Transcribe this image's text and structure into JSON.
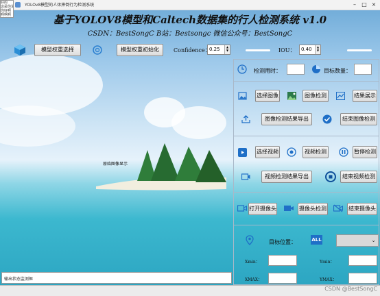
{
  "window": {
    "title": "YOLOv8模型的人体摔倒行为检测系统"
  },
  "sidebox": "好的\n这是你说的\n你好啊\n啊啊啊",
  "header": {
    "title": "基于YOLOV8模型和Caltech数据集的行人检测系统 v1.0",
    "subtitle": "CSDN：BestSongC   B站：Bestsongc   微信公众号：BestSongC"
  },
  "toolbar": {
    "model_select": "模型权重选择",
    "model_init": "模型权重初始化",
    "confidence_label": "Confidence：",
    "confidence_value": "0.25",
    "iou_label": "IOU：",
    "iou_value": "0.40"
  },
  "image_area": {
    "placeholder": "原始图像显示"
  },
  "stats": {
    "time_label": "检测用时：",
    "count_label": "目标数量："
  },
  "image_section": {
    "select": "选择图像",
    "detect": "图像检测",
    "show": "结果展示",
    "export": "图像检测结果导出",
    "end": "结束图像检测"
  },
  "video_section": {
    "select": "选择视频",
    "detect": "视频检测",
    "pause": "暂停检测",
    "export": "视频检测结果导出",
    "end": "结束视频检测"
  },
  "camera_section": {
    "open": "打开摄像头",
    "detect": "摄像头检测",
    "end": "结束摄像头"
  },
  "target": {
    "position_label": "目标位置：",
    "all_badge": "ALL",
    "xmin": "Xmin：",
    "ymin": "Ymin：",
    "xmax": "XMAX：",
    "ymax": "YMAX："
  },
  "output": {
    "placeholder": "输出状态监测框"
  },
  "watermark": "CSDN @BestSongC",
  "colors": {
    "accent": "#1f6fc7",
    "panel_border": "#a9b8c8"
  }
}
